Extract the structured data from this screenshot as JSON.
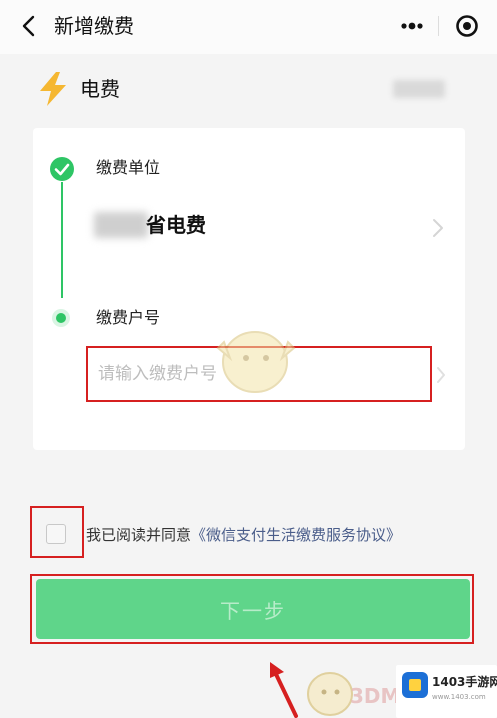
{
  "header": {
    "title": "新增缴费",
    "back_icon": "chevron-left-icon",
    "more_icon": "more-dots-icon",
    "close_icon": "target-circle-icon"
  },
  "service": {
    "icon": "lightning-bolt-icon",
    "name": "电费",
    "accent_color": "#f5b731"
  },
  "form": {
    "step1": {
      "label": "缴费单位",
      "value": "省电费",
      "status": "completed"
    },
    "step2": {
      "label": "缴费户号",
      "placeholder": "请输入缴费户号",
      "value": ""
    },
    "step_color": "#2ec565"
  },
  "agreement": {
    "prefix": "我已阅读并同意",
    "link": "《微信支付生活缴费服务协议》",
    "checked": false
  },
  "actions": {
    "next_label": "下一步",
    "button_color": "#5fd58a"
  },
  "annotation_color": "#d62020",
  "watermark": {
    "site": "1403手游网",
    "site_url_small": "www.1403.com",
    "brand": "3DM"
  }
}
